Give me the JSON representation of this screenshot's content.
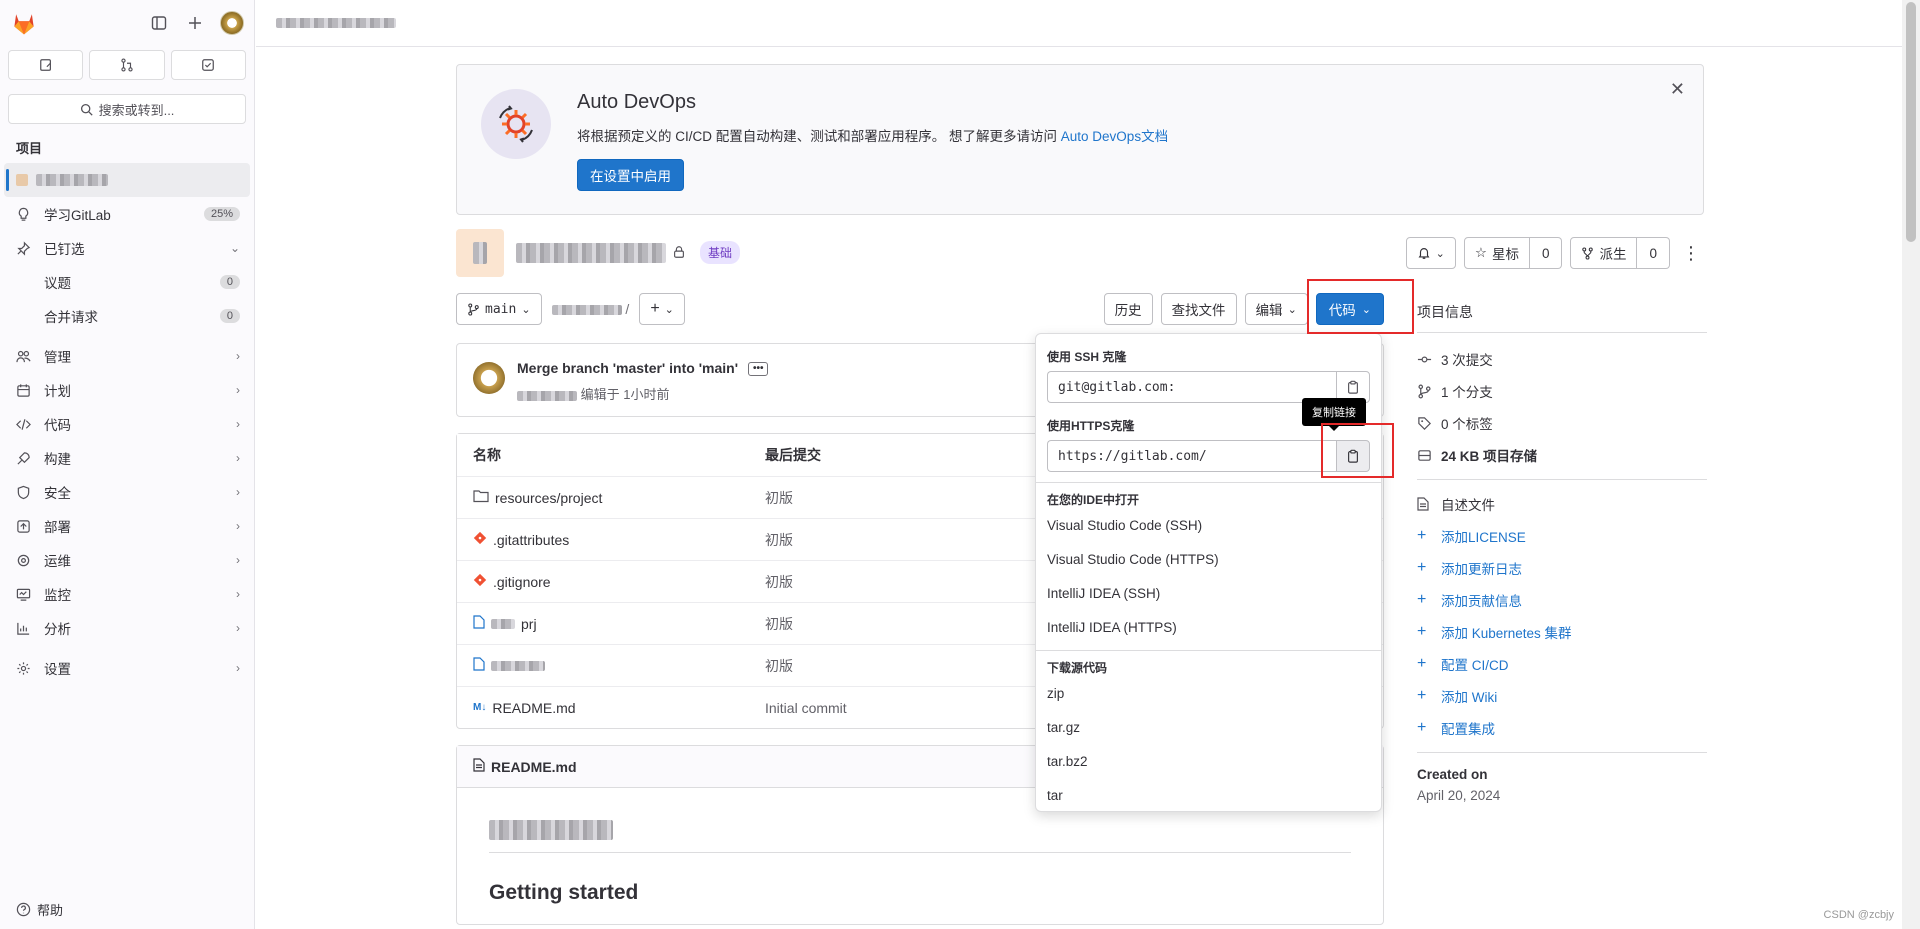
{
  "sidebar": {
    "search_label": "搜索或转到...",
    "section_label": "项目",
    "learn_label": "学习GitLab",
    "learn_progress": "25%",
    "pinned_label": "已钉选",
    "pinned_items": [
      {
        "label": "议题",
        "count": "0"
      },
      {
        "label": "合并请求",
        "count": "0"
      }
    ],
    "nav": [
      {
        "label": "管理",
        "icon": "users-icon"
      },
      {
        "label": "计划",
        "icon": "calendar-icon"
      },
      {
        "label": "代码",
        "icon": "code-icon"
      },
      {
        "label": "构建",
        "icon": "rocket-icon"
      },
      {
        "label": "安全",
        "icon": "shield-icon"
      },
      {
        "label": "部署",
        "icon": "deploy-icon"
      },
      {
        "label": "运维",
        "icon": "operate-icon"
      },
      {
        "label": "监控",
        "icon": "monitor-icon"
      },
      {
        "label": "分析",
        "icon": "chart-icon"
      }
    ],
    "settings_label": "设置",
    "help_label": "帮助"
  },
  "devops": {
    "title": "Auto DevOps",
    "desc": "将根据预定义的 CI/CD 配置自动构建、测试和部署应用程序。 想了解更多请访问",
    "link": "Auto DevOps文档",
    "button": "在设置中启用"
  },
  "project": {
    "badge": "基础",
    "star_label": "星标",
    "star_count": "0",
    "fork_label": "派生",
    "fork_count": "0"
  },
  "toolbar": {
    "branch": "main",
    "path_sep": "/",
    "history": "历史",
    "find_file": "查找文件",
    "edit": "编辑",
    "code": "代码"
  },
  "commit": {
    "title": "Merge branch 'master' into 'main'",
    "meta": "编辑于 1小时前"
  },
  "files": {
    "headers": [
      "名称",
      "最后提交"
    ],
    "rows": [
      {
        "name": "resources/project",
        "commit": "初版",
        "icon": "folder-icon"
      },
      {
        "name": ".gitattributes",
        "commit": "初版",
        "icon": "git-icon"
      },
      {
        "name": ".gitignore",
        "commit": "初版",
        "icon": "git-icon"
      },
      {
        "name": "prj",
        "commit": "初版",
        "icon": "file-icon"
      },
      {
        "name": "",
        "commit": "初版",
        "icon": "file-icon"
      },
      {
        "name": "README.md",
        "commit": "Initial commit",
        "icon": "markdown-icon"
      }
    ]
  },
  "readme": {
    "filename": "README.md",
    "heading": "Getting started"
  },
  "clone": {
    "ssh_label": "使用 SSH 克隆",
    "ssh_url": "git@gitlab.com:",
    "https_label": "使用HTTPS克隆",
    "https_url": "https://gitlab.com/",
    "ide_label": "在您的IDE中打开",
    "ide_items": [
      "Visual Studio Code (SSH)",
      "Visual Studio Code (HTTPS)",
      "IntelliJ IDEA (SSH)",
      "IntelliJ IDEA (HTTPS)"
    ],
    "download_label": "下载源代码",
    "download_items": [
      "zip",
      "tar.gz",
      "tar.bz2",
      "tar"
    ],
    "tooltip": "复制链接"
  },
  "info": {
    "title": "项目信息",
    "stats": [
      {
        "label": "3 次提交",
        "icon": "commit-icon"
      },
      {
        "label": "1 个分支",
        "icon": "branch-icon"
      },
      {
        "label": "0 个标签",
        "icon": "tag-icon"
      },
      {
        "label": "24 KB 项目存储",
        "icon": "storage-icon"
      }
    ],
    "readme": "自述文件",
    "links": [
      "添加LICENSE",
      "添加更新日志",
      "添加贡献信息",
      "添加 Kubernetes 集群",
      "配置 CI/CD",
      "添加 Wiki",
      "配置集成"
    ],
    "created_label": "Created on",
    "created_date": "April 20, 2024"
  },
  "watermark": "CSDN @zcbjy"
}
